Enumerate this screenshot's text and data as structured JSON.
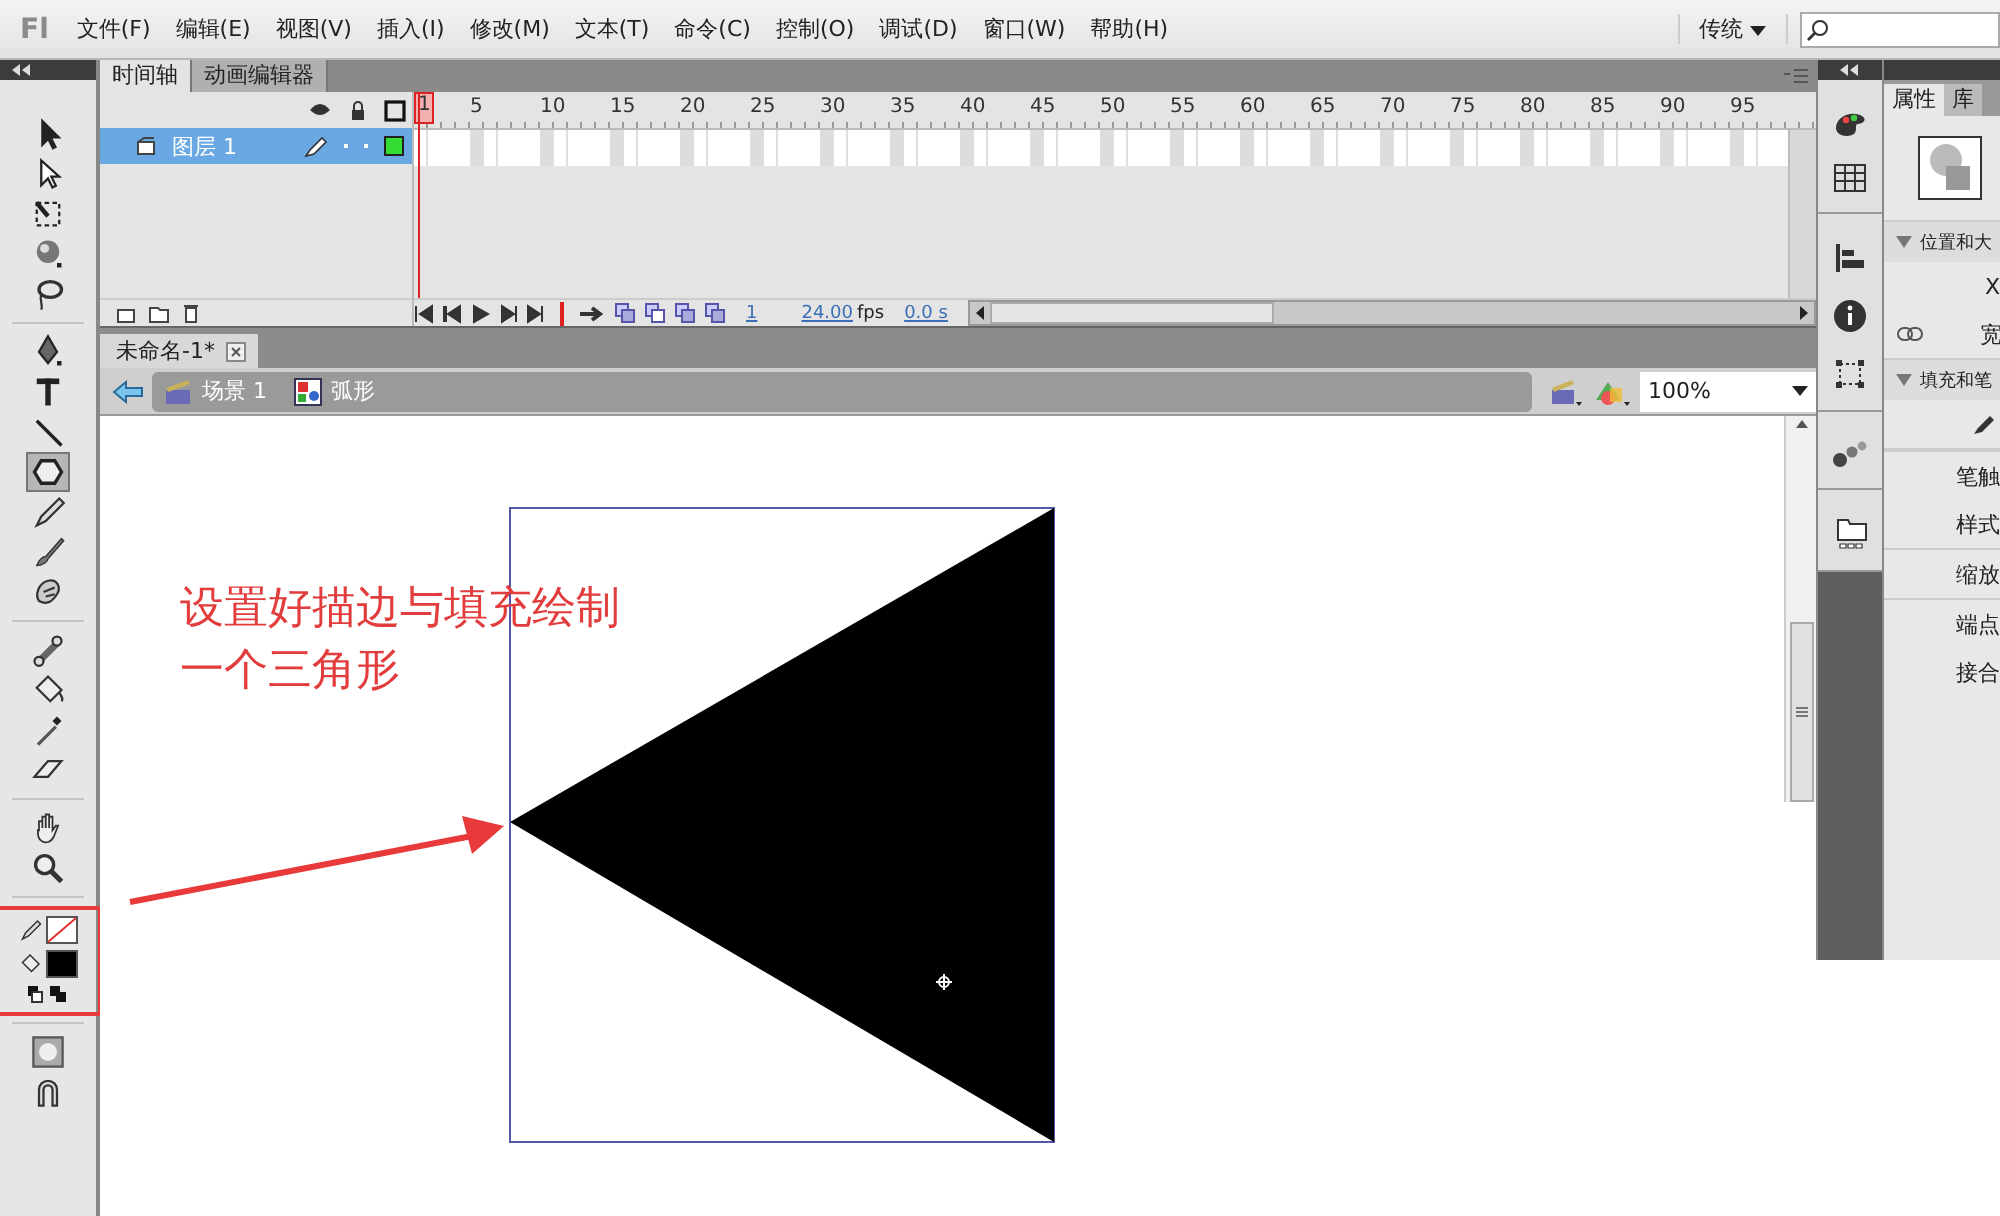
{
  "app_logo": "Fl",
  "menu": [
    "文件(F)",
    "编辑(E)",
    "视图(V)",
    "插入(I)",
    "修改(M)",
    "文本(T)",
    "命令(C)",
    "控制(O)",
    "调试(D)",
    "窗口(W)",
    "帮助(H)"
  ],
  "workspace": "传统",
  "tools": [
    {
      "kind": "select",
      "selected": false
    },
    {
      "kind": "subselect",
      "selected": false
    },
    {
      "kind": "transform",
      "selected": false
    },
    {
      "kind": "sphere",
      "selected": false
    },
    {
      "kind": "lasso",
      "selected": false
    },
    {
      "kind": "pen",
      "selected": false
    },
    {
      "kind": "text",
      "selected": false
    },
    {
      "kind": "line",
      "selected": false
    },
    {
      "kind": "polystar",
      "selected": true
    },
    {
      "kind": "pencil",
      "selected": false
    },
    {
      "kind": "brush",
      "selected": false
    },
    {
      "kind": "deco",
      "selected": false
    },
    {
      "kind": "bone",
      "selected": false
    },
    {
      "kind": "bucket",
      "selected": false
    },
    {
      "kind": "eyedropper",
      "selected": false
    },
    {
      "kind": "eraser",
      "selected": false
    },
    {
      "kind": "hand",
      "selected": false
    },
    {
      "kind": "zoom",
      "selected": false
    }
  ],
  "stroke_swatch": {
    "none": true
  },
  "fill_swatch": {
    "color": "#000000"
  },
  "timeline": {
    "tabs": [
      {
        "label": "时间轴",
        "selected": true
      },
      {
        "label": "动画编辑器",
        "selected": false
      }
    ],
    "frame_numbers": [
      "1",
      "5",
      "10",
      "15",
      "20",
      "25",
      "30",
      "35",
      "40",
      "45",
      "50",
      "55",
      "60",
      "65",
      "70",
      "75",
      "80",
      "85",
      "90",
      "95"
    ],
    "layers": [
      {
        "name": "图层 1",
        "selected": true
      }
    ],
    "current_frame": "1",
    "fps": "24.00",
    "fps_unit": "fps",
    "time": "0.0 s"
  },
  "document_tab": {
    "title": "未命名-1*"
  },
  "breadcrumbs": [
    "场景 1",
    "弧形"
  ],
  "zoom": "100%",
  "annotation": [
    "设置好描边与填充绘制",
    "一个三角形"
  ],
  "properties": {
    "tabs": [
      {
        "label": "属性",
        "selected": true
      },
      {
        "label": "库",
        "selected": false
      }
    ],
    "section_1": "位置和大",
    "x_label": "X",
    "width_label": "宽",
    "section_2": "填充和笔",
    "labels": [
      "笔触",
      "样式",
      "缩放",
      "端点",
      "接合"
    ]
  }
}
